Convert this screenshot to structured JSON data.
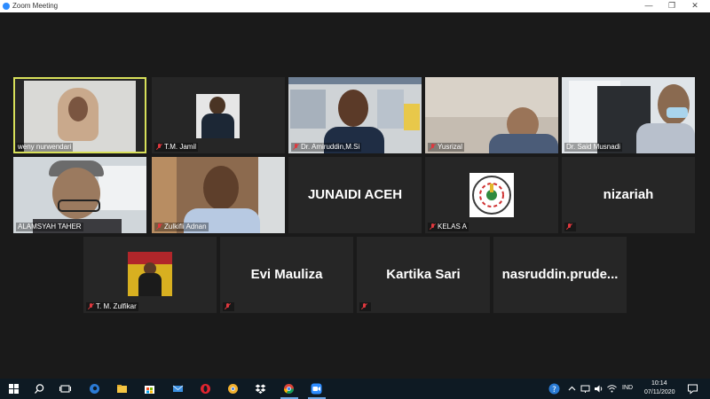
{
  "window": {
    "title": "Zoom Meeting"
  },
  "participants": {
    "weny": {
      "name": "weny nurwendari"
    },
    "tm_jamil": {
      "name": "T.M. Jamil"
    },
    "amiruddin": {
      "name": "Dr. Amiruddin,M.Si"
    },
    "yusrizal": {
      "name": "Yusrizal"
    },
    "said": {
      "name": "Dr. Said Musnadi"
    },
    "alamsyah": {
      "name": "ALAMSYAH TAHER"
    },
    "zulkifli": {
      "name": "Zulkifli Adnan"
    },
    "junaidi": {
      "name": "JUNAIDI ACEH"
    },
    "kelas": {
      "name": "KELAS A"
    },
    "nizariah": {
      "name": "nizariah"
    },
    "zulfikar": {
      "name": "T. M. Zulfikar"
    },
    "evi": {
      "name": "Evi Mauliza"
    },
    "kartika": {
      "name": "Kartika Sari"
    },
    "nasruddin": {
      "name": "nasruddin.prude..."
    }
  },
  "taskbar": {
    "language": "IND",
    "time": "10:14",
    "date": "07/11/2020"
  },
  "colors": {
    "active_speaker": "#d8e05a",
    "muted": "#e0383e",
    "taskbar": "#0e1a23",
    "stage": "#1a1a1a"
  }
}
